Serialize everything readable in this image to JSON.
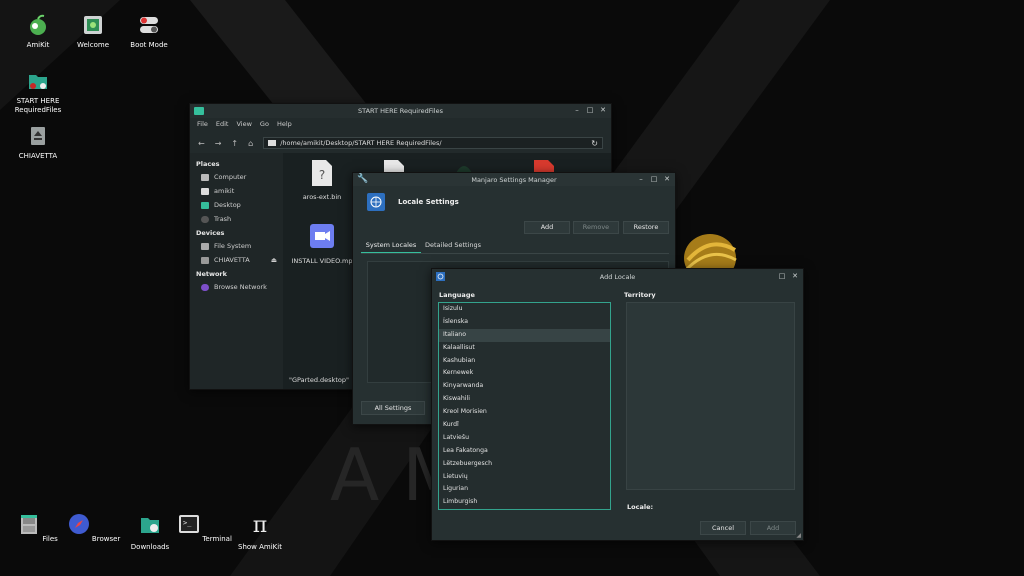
{
  "desktop": {
    "icons": [
      {
        "label": "AmiKit"
      },
      {
        "label": "Welcome"
      },
      {
        "label": "Boot Mode"
      },
      {
        "label": "START HERE RequiredFiles"
      },
      {
        "label": "CHIAVETTA"
      }
    ],
    "wallpaper_letters": "A   M"
  },
  "file_manager": {
    "title": "START HERE RequiredFiles",
    "menu": [
      "File",
      "Edit",
      "View",
      "Go",
      "Help"
    ],
    "path": "/home/amikit/Desktop/START HERE RequiredFiles/",
    "sidebar": {
      "places_header": "Places",
      "places": [
        "Computer",
        "amikit",
        "Desktop",
        "Trash"
      ],
      "devices_header": "Devices",
      "devices": [
        "File System",
        "CHIAVETTA"
      ],
      "network_header": "Network",
      "network": [
        "Browse Network"
      ]
    },
    "files": [
      {
        "name": "aros-ext.bin"
      },
      {
        "name": "INSTALL VIDEO.mp"
      },
      {
        "name": "\"GParted.desktop\""
      }
    ]
  },
  "settings_manager": {
    "title": "Manjaro Settings Manager",
    "section_title": "Locale Settings",
    "add_label": "Add",
    "remove_label": "Remove",
    "restore_label": "Restore",
    "tabs": [
      "System Locales",
      "Detailed Settings"
    ],
    "all_settings_label": "All Settings"
  },
  "add_locale": {
    "title": "Add Locale",
    "language_label": "Language",
    "territory_label": "Territory",
    "languages": [
      "Isizulu",
      "Íslenska",
      "Italiano",
      "Kalaallisut",
      "Kashubian",
      "Kernewek",
      "Kinyarwanda",
      "Kiswahili",
      "Kreol Morisien",
      "Kurdî",
      "Latviešu",
      "Lea Fakatonga",
      "Lëtzebuergesch",
      "Lietuvių",
      "Ligurian",
      "Limburgish"
    ],
    "selected_language": "Italiano",
    "locale_label": "Locale:",
    "cancel_label": "Cancel",
    "add_label": "Add"
  },
  "dock": {
    "items": [
      {
        "label": "Files"
      },
      {
        "label": "Browser"
      },
      {
        "label": "Downloads"
      },
      {
        "label": "Terminal"
      },
      {
        "label": "Show AmiKit"
      }
    ]
  },
  "colors": {
    "accent": "#35bf9c",
    "window_bg": "#263031",
    "desktop_bg": "#0b0b0b"
  }
}
